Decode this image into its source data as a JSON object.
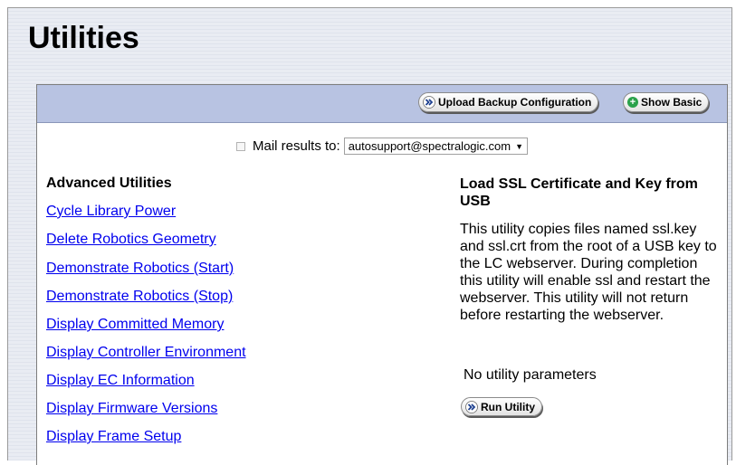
{
  "page": {
    "title": "Utilities"
  },
  "toolbar": {
    "upload_label": "Upload Backup Configuration",
    "show_basic_label": "Show Basic"
  },
  "mail": {
    "checked": false,
    "label": "Mail results to:",
    "selected": "autosupport@spectralogic.com"
  },
  "advanced": {
    "heading": "Advanced Utilities",
    "items": [
      "Cycle Library Power",
      "Delete Robotics Geometry",
      "Demonstrate Robotics (Start)",
      "Demonstrate Robotics (Stop)",
      "Display Committed Memory",
      "Display Controller Environment",
      "Display EC Information",
      "Display Firmware Versions",
      "Display Frame Setup"
    ]
  },
  "detail": {
    "title": "Load SSL Certificate and Key from USB",
    "description": "This utility copies files named ssl.key and ssl.crt from the root of a USB key to the LC webserver. During completion this utility will enable ssl and restart the webserver. This utility will not return before restarting the webserver.",
    "params_text": "No utility parameters",
    "run_label": "Run Utility"
  },
  "colors": {
    "toolbar": "#b8c3e2",
    "link": "#0000ee",
    "add_icon": "#2aa14a"
  }
}
